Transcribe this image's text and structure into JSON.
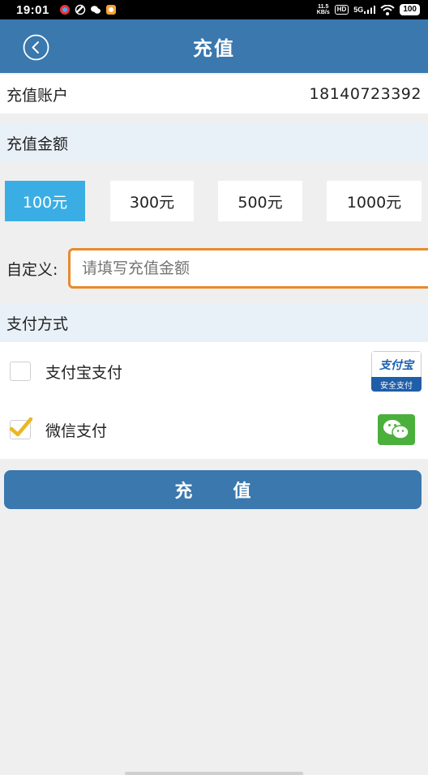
{
  "status_bar": {
    "time": "19:01",
    "speed_top": "11.5",
    "speed_bottom": "KB/s",
    "hd": "HD",
    "network": "5G",
    "battery": "100"
  },
  "header": {
    "title": "充值",
    "back_icon": "chevron-left-circle-icon"
  },
  "account": {
    "label": "充值账户",
    "value": "18140723392"
  },
  "amount_section": {
    "title": "充值金额",
    "options": [
      "100元",
      "300元",
      "500元",
      "1000元"
    ],
    "selected_index": 0
  },
  "custom_amount": {
    "label": "自定义:",
    "value": "",
    "placeholder": "请填写充值金额"
  },
  "payment_section": {
    "title": "支付方式",
    "methods": [
      {
        "label": "支付宝支付",
        "checked": false,
        "logo_text": "支付宝",
        "logo_sub": "安全支付"
      },
      {
        "label": "微信支付",
        "checked": true
      }
    ]
  },
  "submit_label": "充值",
  "colors": {
    "primary": "#3a78ae",
    "selected_amount": "#3aaee4",
    "input_border": "#e88a2a",
    "wechat_green": "#4ab03b",
    "check_yellow": "#e9b822"
  }
}
